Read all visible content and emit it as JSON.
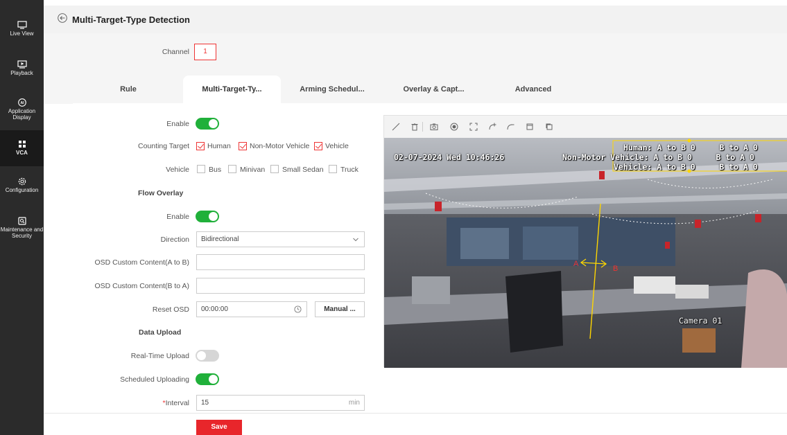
{
  "sidebar": {
    "items": [
      {
        "label": "Live View",
        "icon": "monitor-icon"
      },
      {
        "label": "Playback",
        "icon": "play-icon"
      },
      {
        "label": "Application Display",
        "icon": "ai-icon"
      },
      {
        "label": "VCA",
        "icon": "grid-icon"
      },
      {
        "label": "Configuration",
        "icon": "gear-icon"
      },
      {
        "label": "Maintenance and Security",
        "icon": "shield-icon"
      }
    ]
  },
  "header": {
    "title": "Multi-Target-Type Detection"
  },
  "channel": {
    "label": "Channel",
    "value": "1"
  },
  "tabs": [
    "Rule",
    "Multi-Target-Ty...",
    "Arming Schedul...",
    "Overlay & Capt...",
    "Advanced"
  ],
  "form": {
    "enable_label": "Enable",
    "counting_target_label": "Counting Target",
    "counting_targets": [
      "Human",
      "Non-Motor Vehicle",
      "Vehicle"
    ],
    "vehicle_label": "Vehicle",
    "vehicle_types": [
      "Bus",
      "Minivan",
      "Small Sedan",
      "Truck"
    ],
    "flow_overlay_title": "Flow Overlay",
    "flow_enable_label": "Enable",
    "direction_label": "Direction",
    "direction_value": "Bidirectional",
    "osd_a_to_b_label": "OSD Custom Content(A to B)",
    "osd_b_to_a_label": "OSD Custom Content(B to A)",
    "reset_osd_label": "Reset OSD",
    "reset_osd_value": "00:00:00",
    "manual_button": "Manual ...",
    "data_upload_title": "Data Upload",
    "realtime_upload_label": "Real-Time Upload",
    "scheduled_upload_label": "Scheduled Uploading",
    "interval_required": "*",
    "interval_label": "Interval",
    "interval_value": "15",
    "interval_unit": "min",
    "save_button": "Save"
  },
  "video": {
    "timestamp": "02-07-2024 Wed 10:46:26",
    "counter_lines": [
      "Human: A to B 0     B to A 0",
      "Non-Motor Vehicle: A to B 0     B to A 0",
      "Vehicle: A to B 0     B to A 0"
    ],
    "camera_name": "Camera 01",
    "point_a": "A",
    "point_b": "B"
  },
  "colors": {
    "accent": "#e8262b",
    "toggle_on": "#20b03a",
    "sidebar_bg": "#2b2b2b"
  }
}
